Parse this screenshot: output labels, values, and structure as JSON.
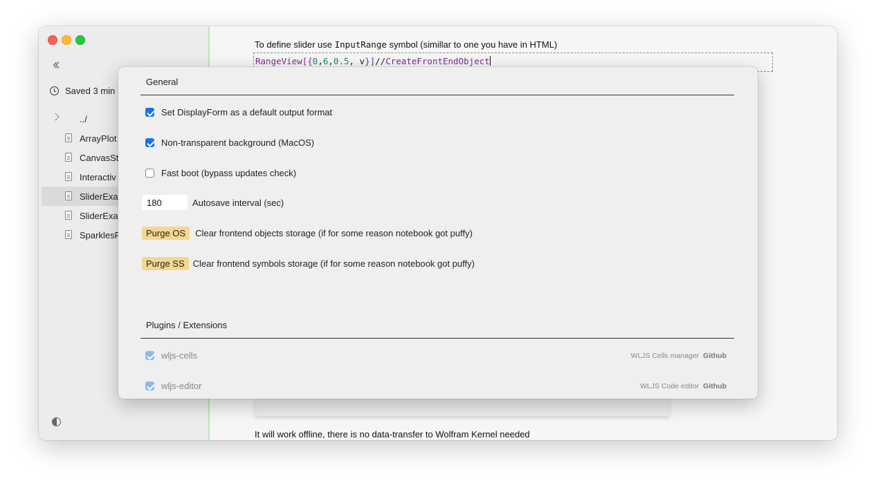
{
  "sidebar": {
    "saved_label": "Saved 3 min",
    "up_dir": "../",
    "files": [
      "ArrayPlot",
      "CanvasSt",
      "Interactiv",
      "SliderExa",
      "SliderExa",
      "SparklesP"
    ],
    "selected_index": 3
  },
  "main": {
    "note1_prefix": "To define slider use ",
    "note1_code": "InputRange",
    "note1_suffix": " symbol (simillar to one you have in HTML)",
    "code": {
      "fn": "RangeView",
      "open": "[{",
      "a": "0",
      "b": "6",
      "c": "0.5",
      "v": " v",
      "close": "}]",
      "comment_prefix": "//",
      "comment": "CreateFrontEndObject"
    },
    "note2": "It will work offline, there is no data-transfer to Wolfram Kernel needed"
  },
  "settings": {
    "general_title": "General",
    "displayform": {
      "label": "Set DisplayForm as a default output format",
      "checked": true
    },
    "nontransparent": {
      "label": "Non-transparent background (MacOS)",
      "checked": true
    },
    "fastboot": {
      "label": "Fast boot (bypass updates check)",
      "checked": false
    },
    "autosave": {
      "value": "180",
      "label": "Autosave interval (sec)"
    },
    "purge_os": {
      "button": "Purge OS",
      "label": "Clear frontend objects storage (if for some reason notebook got puffy)"
    },
    "purge_ss": {
      "button": "Purge SS",
      "label": "Clear frontend symbols storage (if for some reason notebook got puffy)"
    },
    "plugins_title": "Plugins / Extensions",
    "plugins": [
      {
        "name": "wljs-cells",
        "desc": "WLJS Cells manager",
        "link": "Github"
      },
      {
        "name": "wljs-editor",
        "desc": "WLJS Code editor",
        "link": "Github"
      }
    ]
  },
  "colors": {
    "accent": "#1a73e8",
    "purge_button": "#f3d78f",
    "divider_green": "#b9e6b5"
  }
}
